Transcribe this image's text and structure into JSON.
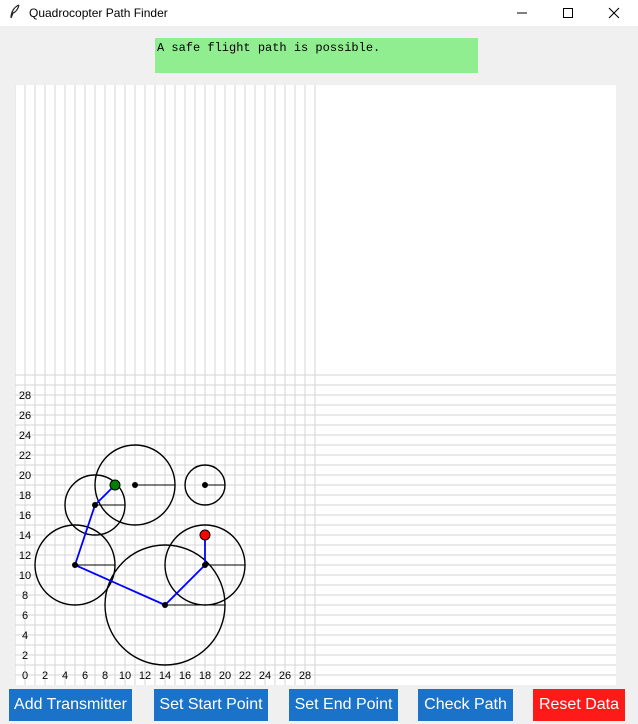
{
  "window": {
    "title": "Quadrocopter Path Finder",
    "controls": [
      "minimize-icon",
      "maximize-icon",
      "close-icon"
    ]
  },
  "status": {
    "message": "A safe flight path is possible.",
    "color": "#90ee90"
  },
  "plot": {
    "axis_range": [
      0,
      30
    ],
    "x_ticks": [
      "0",
      "2",
      "4",
      "6",
      "8",
      "10",
      "12",
      "14",
      "16",
      "18",
      "20",
      "22",
      "24",
      "26",
      "28"
    ],
    "y_ticks": [
      "2",
      "4",
      "6",
      "8",
      "10",
      "12",
      "14",
      "16",
      "18",
      "20",
      "22",
      "24",
      "26",
      "28"
    ],
    "grid": true,
    "transmitters": [
      {
        "x": 6,
        "y": 11,
        "r": 4
      },
      {
        "x": 8,
        "y": 17,
        "r": 3
      },
      {
        "x": 12,
        "y": 19,
        "r": 4
      },
      {
        "x": 19,
        "y": 19,
        "r": 2
      },
      {
        "x": 15,
        "y": 7,
        "r": 6
      },
      {
        "x": 19,
        "y": 11,
        "r": 4
      }
    ],
    "start_point": {
      "x": 19,
      "y": 14,
      "color": "#ff0000"
    },
    "end_point": {
      "x": 10,
      "y": 19,
      "color": "#008000"
    },
    "path": [
      [
        19,
        14
      ],
      [
        19,
        11
      ],
      [
        15,
        7
      ],
      [
        6,
        11
      ],
      [
        8,
        17
      ],
      [
        10,
        19
      ]
    ],
    "path_color": "#0000ff"
  },
  "buttons": {
    "add_transmitter": "Add Transmitter",
    "set_start": "Set Start Point",
    "set_end": "Set End Point",
    "check_path": "Check Path",
    "reset": "Reset Data",
    "primary_color": "#1a73c8",
    "danger_color": "#ff1a1a"
  }
}
